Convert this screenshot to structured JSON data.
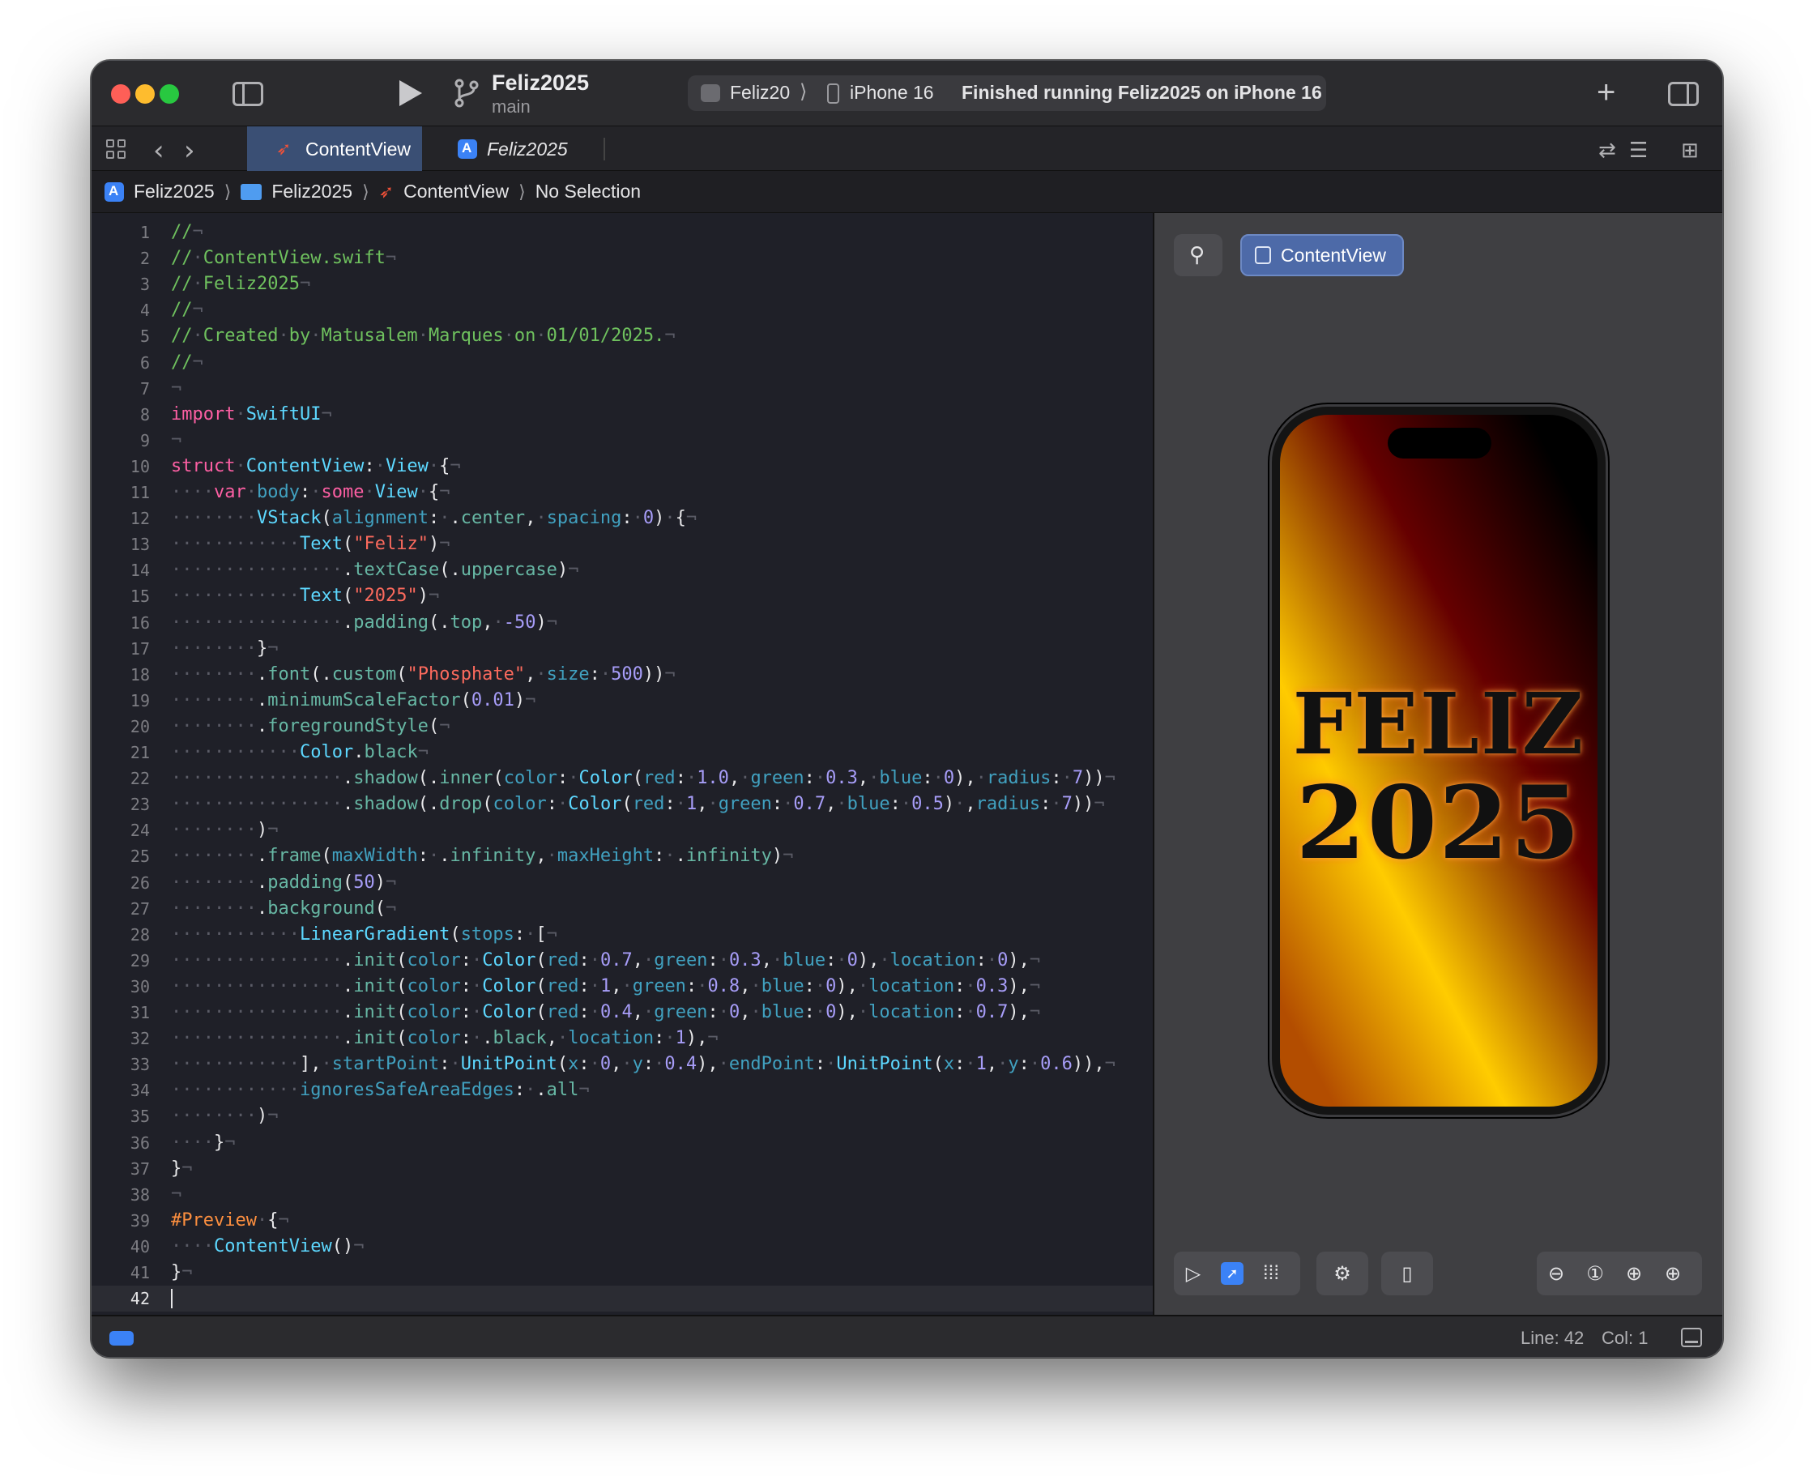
{
  "window": {
    "project_title": "Feliz2025",
    "branch": "main",
    "activity": {
      "scheme": "Feliz20",
      "device": "iPhone 16",
      "status": "Finished running Feliz2025 on iPhone 16"
    },
    "traffic_colors": {
      "close": "#fe5f57",
      "minimize": "#febc2e",
      "maximize": "#28c840"
    }
  },
  "tabs": [
    {
      "label": "ContentView",
      "icon": "swift-icon",
      "active": true
    },
    {
      "label": "Feliz2025",
      "icon": "xcode-project-icon",
      "active": false
    }
  ],
  "breadcrumb": [
    "Feliz2025",
    "Feliz2025",
    "ContentView",
    "No Selection"
  ],
  "editor": {
    "current_line": 42,
    "lines": [
      "//¬",
      "//·ContentView.swift¬",
      "//·Feliz2025¬",
      "//¬",
      "//·Created·by·Matusalem·Marques·on·01/01/2025.¬",
      "//¬",
      "¬",
      "import·SwiftUI¬",
      "¬",
      "struct·ContentView:·View·{¬",
      "····var·body:·some·View·{¬",
      "········VStack(alignment:·.center,·spacing:·0)·{¬",
      "············Text(\"Feliz\")¬",
      "················.textCase(.uppercase)¬",
      "············Text(\"2025\")¬",
      "················.padding(.top,·-50)¬",
      "········}¬",
      "········.font(.custom(\"Phosphate\",·size:·500))¬",
      "········.minimumScaleFactor(0.01)¬",
      "········.foregroundStyle(¬",
      "············Color.black¬",
      "················.shadow(.inner(color:·Color(red:·1.0,·green:·0.3,·blue:·0),·radius:·7))¬",
      "················.shadow(.drop(color:·Color(red:·1,·green:·0.7,·blue:·0.5)·,radius:·7))¬",
      "········)¬",
      "········.frame(maxWidth:·.infinity,·maxHeight:·.infinity)¬",
      "········.padding(50)¬",
      "········.background(¬",
      "············LinearGradient(stops:·[¬",
      "················.init(color:·Color(red:·0.7,·green:·0.3,·blue:·0),·location:·0),¬",
      "················.init(color:·Color(red:·1,·green:·0.8,·blue:·0),·location:·0.3),¬",
      "················.init(color:·Color(red:·0.4,·green:·0,·blue:·0),·location:·0.7),¬",
      "················.init(color:·.black,·location:·1),¬",
      "············],·startPoint:·UnitPoint(x:·0,·y:·0.4),·endPoint:·UnitPoint(x:·1,·y:·0.6)),¬",
      "············ignoresSafeAreaEdges:·.all¬",
      "········)¬",
      "····}¬",
      "}¬",
      "¬",
      "#Preview·{¬",
      "····ContentView()¬",
      "}¬",
      ""
    ]
  },
  "preview": {
    "view_button": "ContentView",
    "screen_text": [
      "FELIZ",
      "2025"
    ],
    "zoom_controls": [
      "zoom-out-icon",
      "zoom-actual-icon",
      "zoom-fit-icon",
      "zoom-in-icon"
    ]
  },
  "status": {
    "position": "Line: 42",
    "column": "Col: 1"
  },
  "colors": {
    "accent": "#3b82f6",
    "swift": "#f05138",
    "comment": "#6fc15e",
    "keyword": "#fc5fa3",
    "type": "#5dd8ff",
    "string": "#fc6a5d",
    "number": "#a79df8"
  }
}
